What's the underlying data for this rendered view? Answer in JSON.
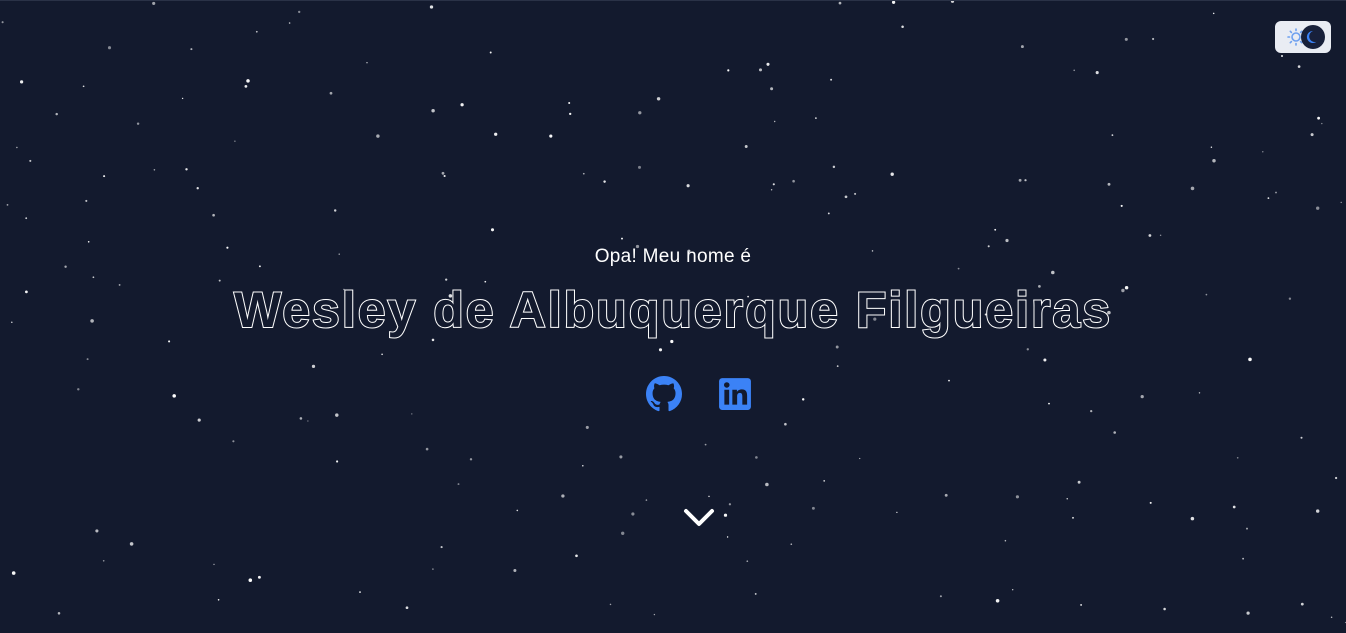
{
  "hero": {
    "greeting": "Opa! Meu nome é",
    "name": "Wesley de Albuquerque Filgueiras"
  },
  "socials": [
    {
      "icon": "github-icon",
      "color": "#3b82f6"
    },
    {
      "icon": "linkedin-icon",
      "color": "#3b82f6"
    }
  ],
  "theme_toggle": {
    "light_icon": "sun-icon",
    "dark_icon": "moon-icon",
    "mode": "dark"
  },
  "scroll": {
    "icon": "chevron-down-icon"
  },
  "colors": {
    "background": "#131a2e",
    "accent": "#3b82f6",
    "text": "#ffffff"
  }
}
